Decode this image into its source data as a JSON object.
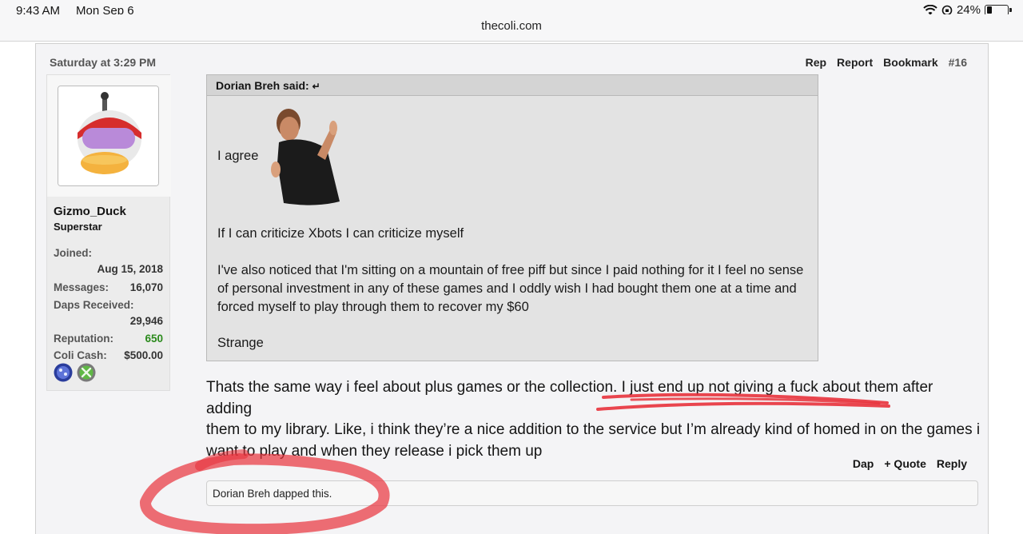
{
  "status_bar": {
    "time": "9:43 AM",
    "date": "Mon Sep 6",
    "battery": "24%",
    "battery_level": 0.24
  },
  "browser": {
    "url": "thecoli.com"
  },
  "post": {
    "date": "Saturday at 3:29 PM",
    "actions": {
      "rep": "Rep",
      "report": "Report",
      "bookmark": "Bookmark",
      "number": "#16"
    },
    "user": {
      "name": "Gizmo_Duck",
      "title": "Superstar",
      "joined_label": "Joined:",
      "joined": "Aug 15, 2018",
      "messages_label": "Messages:",
      "messages": "16,070",
      "daps_label": "Daps Received:",
      "daps": "29,946",
      "reputation_label": "Reputation:",
      "reputation": "650",
      "coli_cash_label": "Coli Cash:",
      "coli_cash": "$500.00"
    },
    "quote": {
      "author": "Dorian Breh said:",
      "return_icon": "↵",
      "line1": "I agree",
      "line2": "If I can criticize Xbots I can criticize myself",
      "para_line1": "I've also noticed that I'm sitting on a mountain of free piff but since I paid nothing for it I feel no sense",
      "para_line2": "of personal investment in any of these games and I oddly wish I had bought them one at a time and",
      "para_line3": "forced myself to play through them to recover my $60",
      "line4": "Strange"
    },
    "body": {
      "line1": "Thats the same way i feel about plus games or the collection. I just end up not giving a fuck about them after adding",
      "line2": "them to my library. Like, i think they’re a nice addition to the service but I’m already kind of homed in on the games i",
      "line3": "want to play and when they release i pick them up"
    },
    "footer": {
      "dap": "Dap",
      "quote": "+ Quote",
      "reply": "Reply"
    },
    "dapped_by": "Dorian Breh dapped this."
  },
  "colors": {
    "annotation_red": "#e8323c",
    "reputation_green": "#2b8a1c"
  }
}
